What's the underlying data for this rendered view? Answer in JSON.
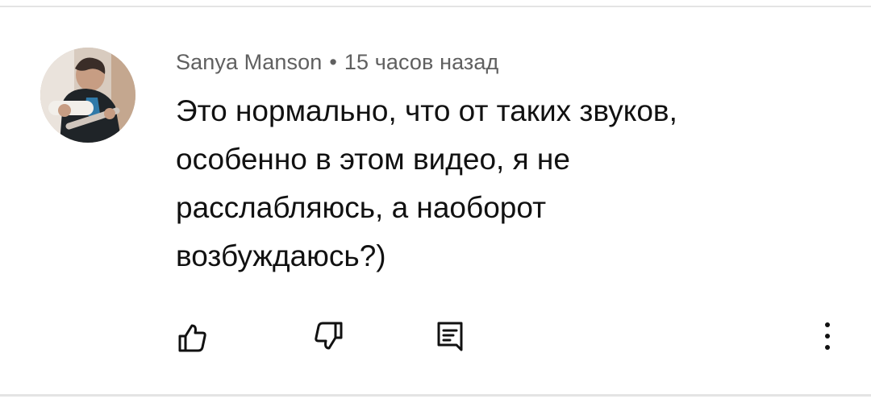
{
  "comment": {
    "author": "Sanya Manson",
    "separator": "•",
    "time": "15 часов назад",
    "lines": [
      "Это нормально, что от таких звуков,",
      "особенно в этом видео, я не",
      "расслабляюсь, а наоборот",
      "возбуждаюсь?)"
    ]
  },
  "actions": {
    "like_icon": "thumb-up-icon",
    "dislike_icon": "thumb-down-icon",
    "reply_icon": "reply-comment-icon",
    "menu_icon": "more-vertical-icon"
  },
  "colors": {
    "meta_text": "#606060",
    "body_text": "#111111",
    "icon": "#111111",
    "divider": "#e4e4e4"
  }
}
